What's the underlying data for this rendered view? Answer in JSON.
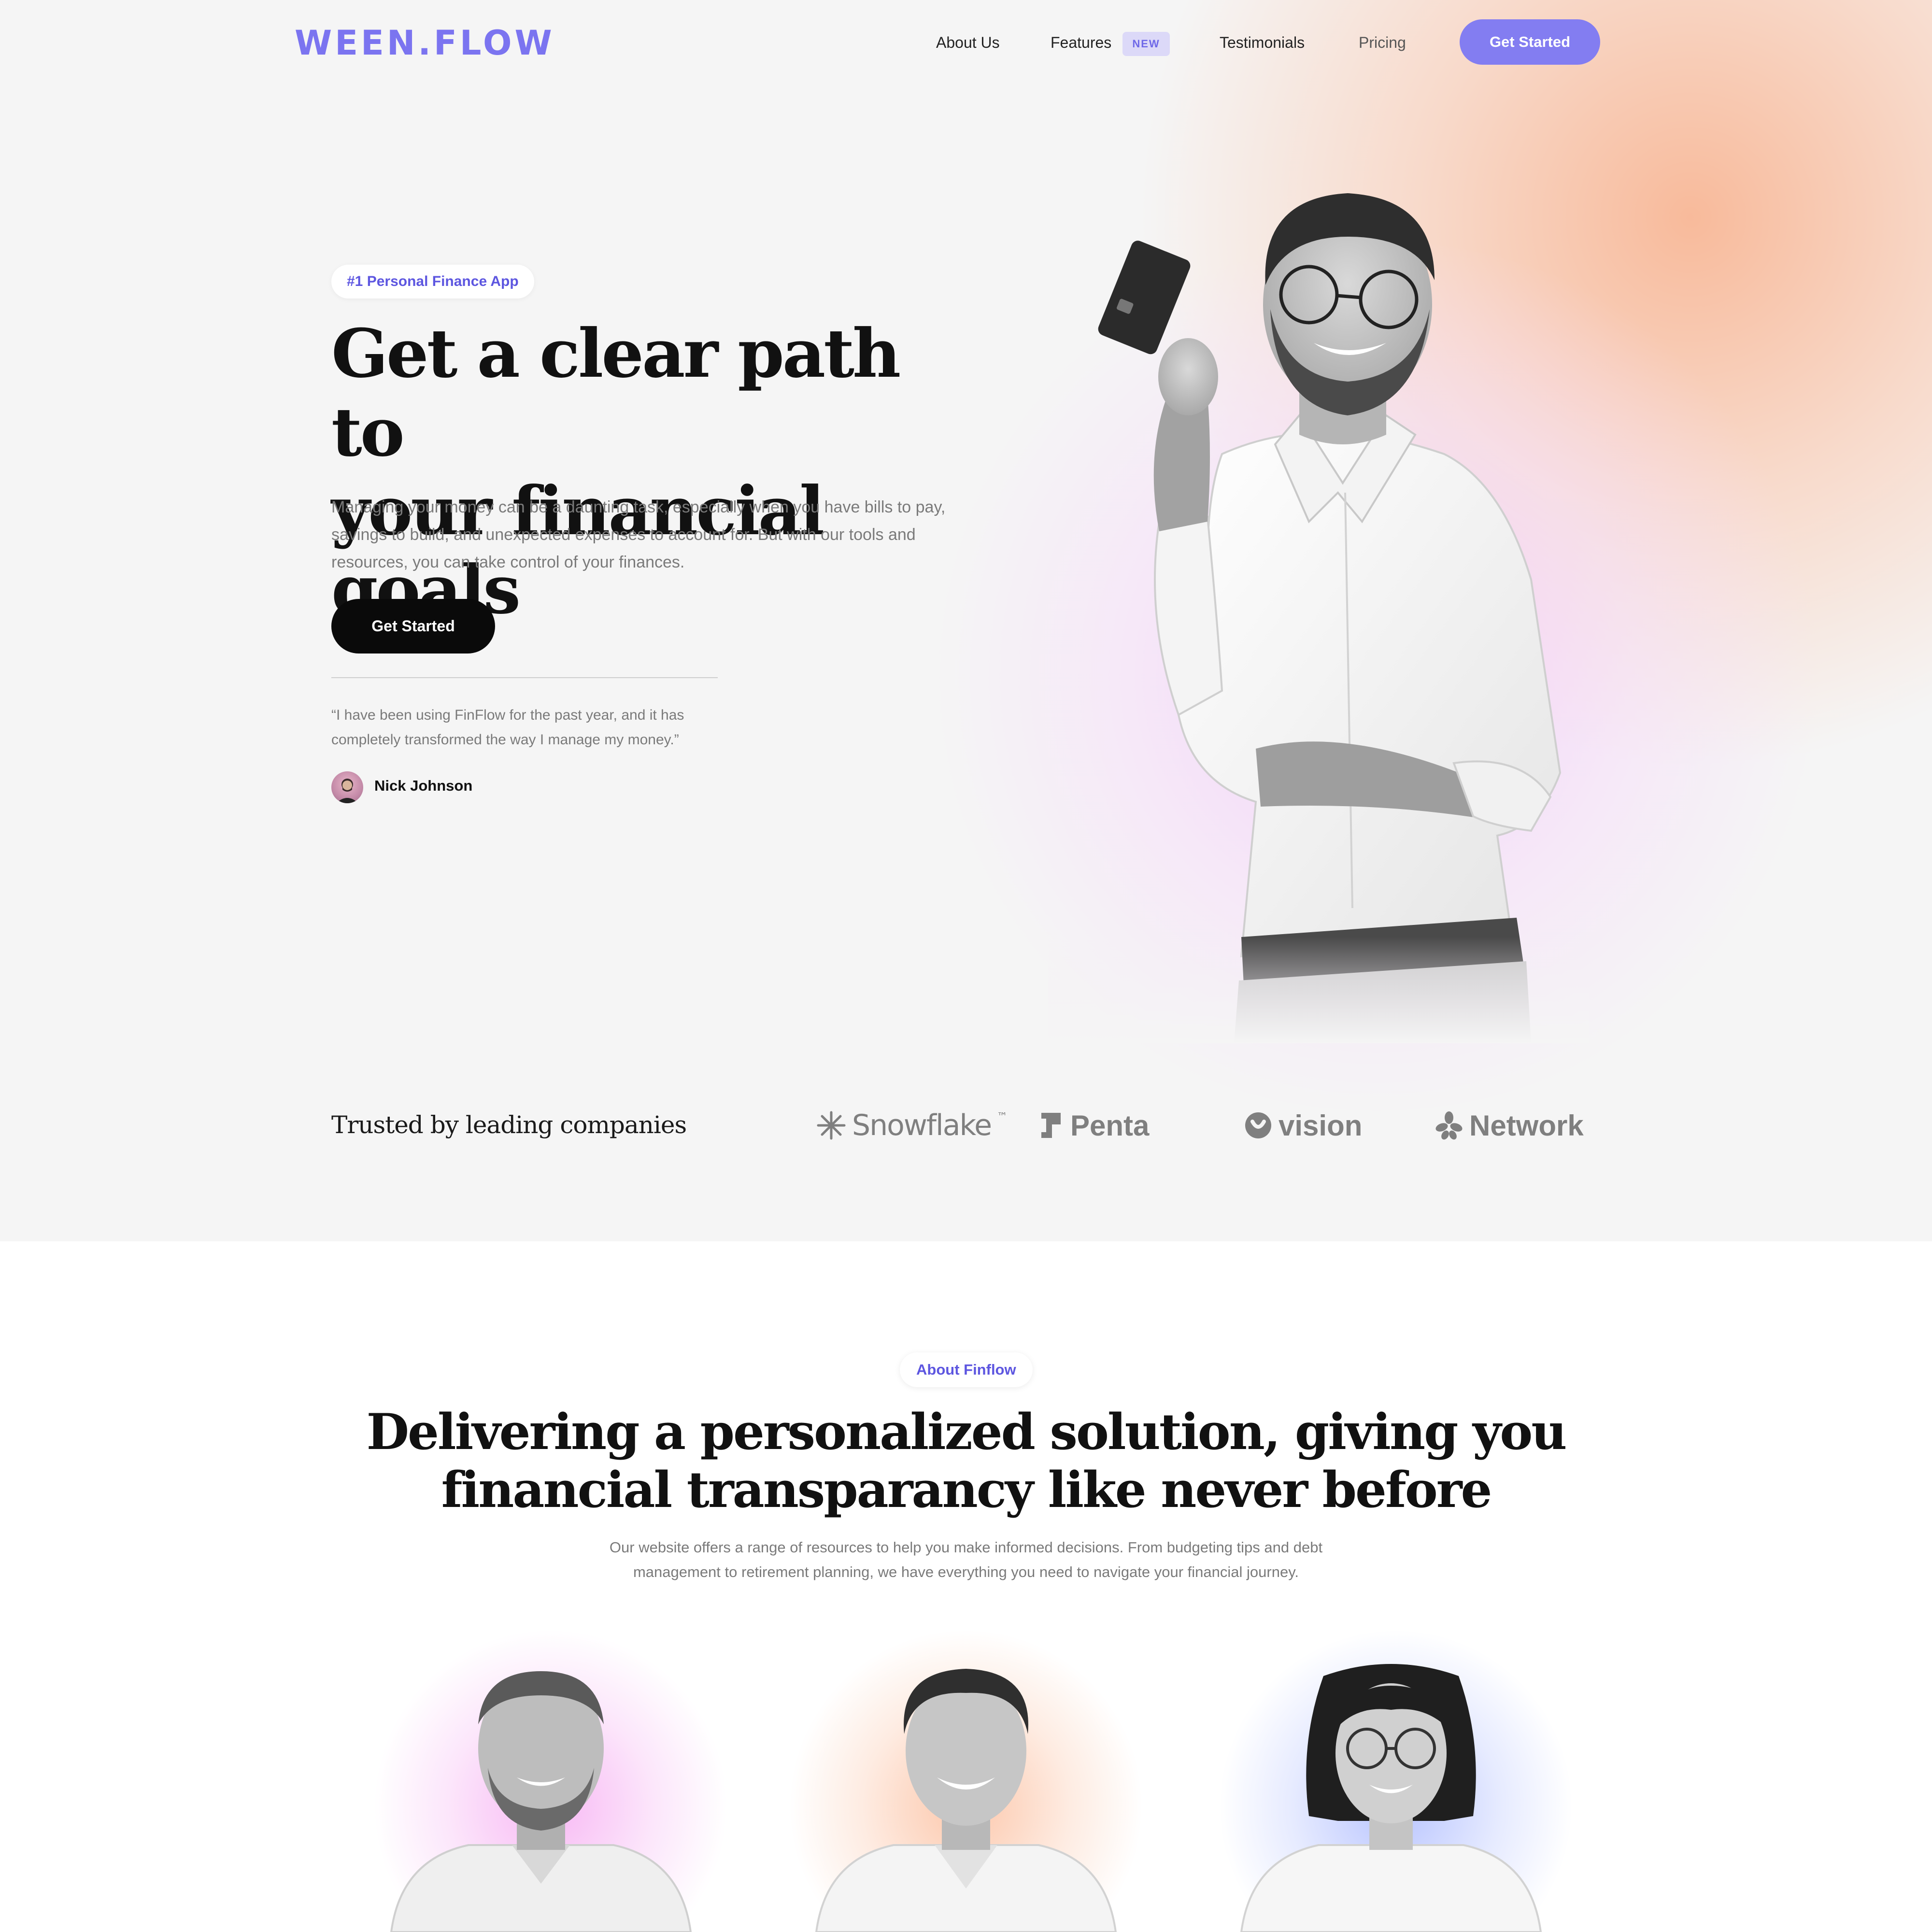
{
  "nav": {
    "logo": "WEEN.FLOW",
    "links": [
      "About Us",
      "Features",
      "Testimonials",
      "Pricing"
    ],
    "features_badge": "NEW",
    "cta": "Get Started"
  },
  "hero": {
    "tag": "#1 Personal Finance App",
    "title_line1": "Get a clear path to",
    "title_line2": "your financial goals",
    "body": "Managing your money can be a daunting task, especially when you have bills to pay, savings to build, and unexpected expenses to account for. But with our tools and resources, you can take control of your finances.",
    "cta": "Get Started",
    "quote_line1": "“I have been using FinFlow for the past year, and it has",
    "quote_line2": "completely transformed the way I manage my money.”",
    "quote_author": "Nick Johnson"
  },
  "trusted": {
    "title": "Trusted by leading companies",
    "brands": [
      "Snowflake",
      "Penta",
      "vision",
      "Network"
    ],
    "snowflake_tm": "™"
  },
  "about": {
    "tag": "About Finflow",
    "title_line1": "Delivering a personalized solution, giving you",
    "title_line2": "financial transparancy like never before",
    "body_line1": "Our website offers a range of resources to help you make informed decisions. From budgeting tips and debt",
    "body_line2": "management to retirement planning, we have everything you need to navigate your financial journey."
  },
  "colors": {
    "brand": "#7b74f0",
    "accent_text": "#5d56e0",
    "cta_dark": "#0a0a0a",
    "hero_bg": "#f5f5f5"
  }
}
